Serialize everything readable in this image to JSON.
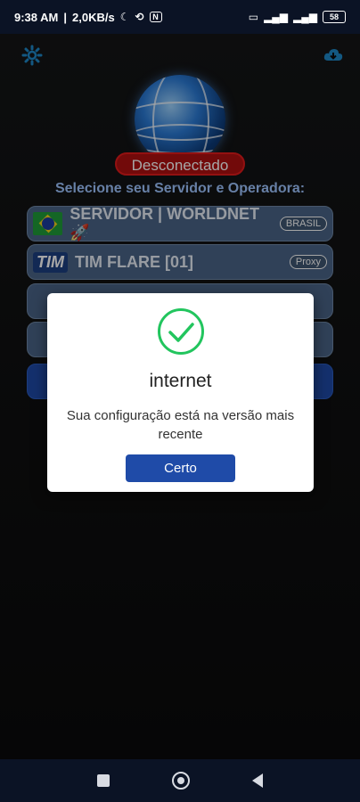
{
  "status_bar": {
    "time": "9:38 AM",
    "speed": "2,0KB/s",
    "battery_level": "58",
    "icons": [
      "moon-icon",
      "sync-icon",
      "nfc-icon",
      "volte-icon",
      "signal-icon",
      "signal-icon",
      "battery-icon"
    ]
  },
  "header": {
    "left_icon": "gear-icon",
    "right_icon": "cloud-download-icon"
  },
  "connection": {
    "status": "Desconectado",
    "select_prompt": "Selecione seu Servidor e Operadora:"
  },
  "server_row": {
    "label": "SERVIDOR | WORLDNET 🚀",
    "tag": "BRASIL",
    "icon": "brazil-flag-icon"
  },
  "operator_row": {
    "logo": "TIM",
    "label": "TIM FLARE [01]",
    "tag": "Proxy"
  },
  "dialog": {
    "icon": "check-circle-icon",
    "title": "internet",
    "message": "Sua configuração está na versão mais recente",
    "button": "Certo"
  },
  "colors": {
    "accent": "#1f4ba8",
    "disconnected": "#b01010",
    "success": "#22c55e",
    "row_bg": "#4b6587"
  }
}
